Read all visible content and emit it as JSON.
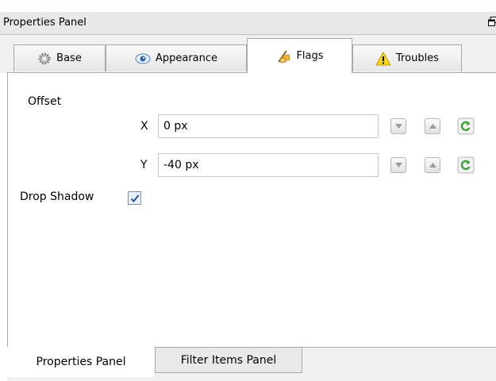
{
  "panel": {
    "title": "Properties Panel"
  },
  "tabs": [
    {
      "label": "Base",
      "icon": "gear-icon"
    },
    {
      "label": "Appearance",
      "icon": "eye-icon"
    },
    {
      "label": "Flags",
      "icon": "flag-icon",
      "active": true
    },
    {
      "label": "Troubles",
      "icon": "warning-icon"
    }
  ],
  "offset": {
    "label": "Offset",
    "x": {
      "label": "X",
      "value": "0 px"
    },
    "y": {
      "label": "Y",
      "value": "-40 px"
    }
  },
  "drop_shadow": {
    "label": "Drop Shadow",
    "checked": true
  },
  "bottom_tabs": [
    {
      "label": "Properties Panel",
      "active": true
    },
    {
      "label": "Filter Items Panel"
    }
  ],
  "colors": {
    "reset_icon": "#3da236",
    "checkbox_check": "#2c4f9e",
    "warning": "#f2c200",
    "flag": "#d4a017"
  }
}
